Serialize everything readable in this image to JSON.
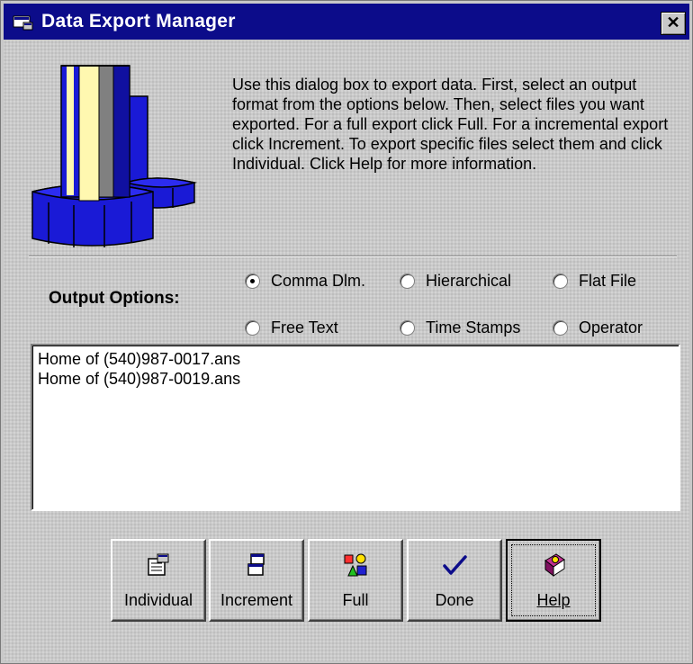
{
  "window": {
    "title": "Data Export Manager",
    "close_label": "✕"
  },
  "description": "Use this dialog box to export data. First, select an output format from the options below. Then, select files you want exported. For a full export click Full. For a incremental export click Increment. To export specific files select them and click Individual. Click Help for more information.",
  "output_options": {
    "label": "Output Options:",
    "options": [
      {
        "label": "Comma Dlm.",
        "selected": true
      },
      {
        "label": "Hierarchical",
        "selected": false
      },
      {
        "label": "Flat File",
        "selected": false
      },
      {
        "label": "Free Text",
        "selected": false
      },
      {
        "label": "Time Stamps",
        "selected": false
      },
      {
        "label": "Operator",
        "selected": false
      }
    ]
  },
  "files": [
    "Home of (540)987-0017.ans",
    "Home of (540)987-0019.ans"
  ],
  "buttons": [
    {
      "label": "Individual",
      "icon": "properties-icon"
    },
    {
      "label": "Increment",
      "icon": "windows-icon"
    },
    {
      "label": "Full",
      "icon": "shapes-icon"
    },
    {
      "label": "Done",
      "icon": "checkmark-icon"
    },
    {
      "label": "Help",
      "icon": "help-book-icon"
    }
  ],
  "colors": {
    "titlebar": "#0c0c8a",
    "face": "#c8c8c8",
    "logo_blue": "#1a1ad6",
    "logo_cream": "#fff8b0"
  }
}
